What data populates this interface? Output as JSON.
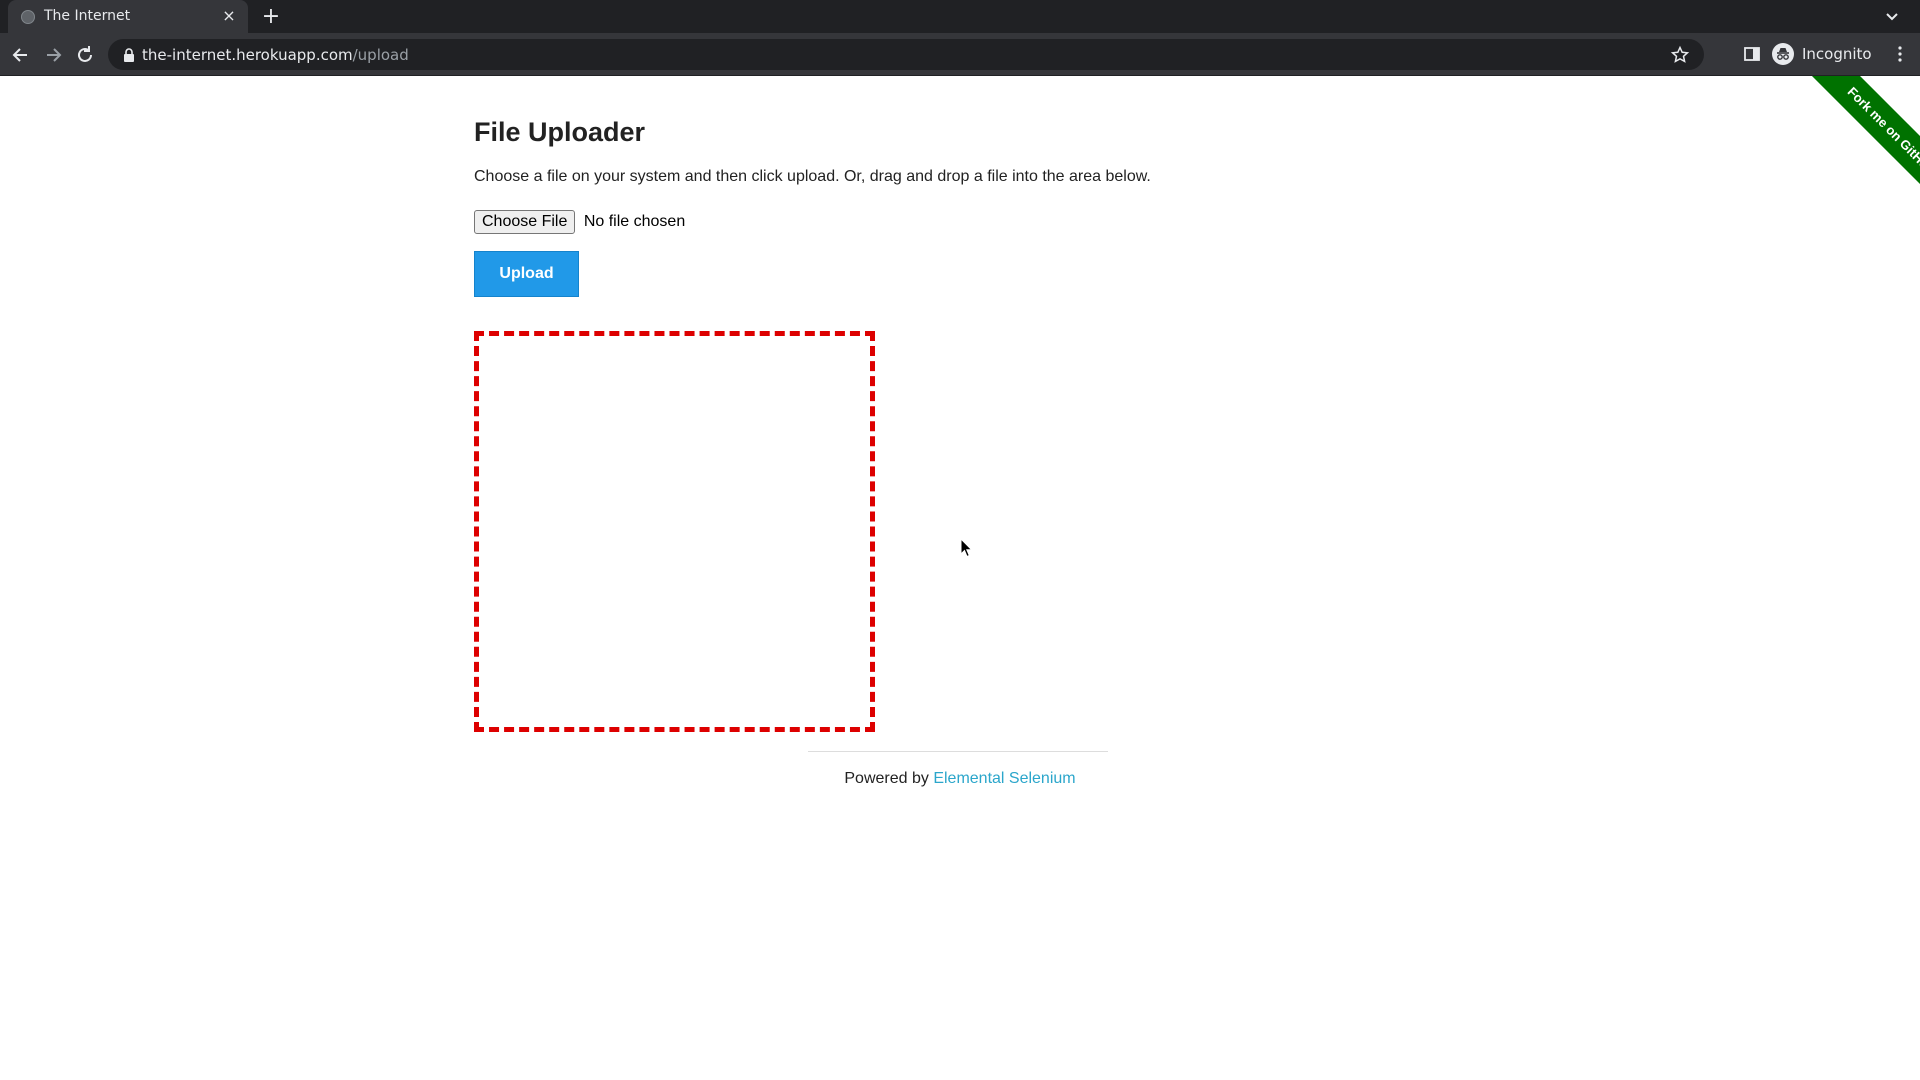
{
  "browser": {
    "tab": {
      "title": "The Internet",
      "close_glyph": "×",
      "favicon": "globe-icon"
    },
    "new_tab_glyph": "+",
    "address": {
      "host": "the-internet.herokuapp.com",
      "path": "/upload"
    },
    "profile": {
      "label": "Incognito"
    }
  },
  "page": {
    "title": "File Uploader",
    "instructions": "Choose a file on your system and then click upload. Or, drag and drop a file into the area below.",
    "file_input": {
      "button_label": "Choose File",
      "status": "No file chosen"
    },
    "upload_button": "Upload",
    "footer": {
      "prefix": "Powered by ",
      "link_text": "Elemental Selenium"
    },
    "ribbon": "Fork me on GitHub"
  },
  "colors": {
    "chrome_dark": "#202124",
    "chrome_tab": "#35363a",
    "upload_button": "#2199e8",
    "drop_zone_border": "#dd0000",
    "link": "#2ba6cb",
    "ribbon": "#007200"
  }
}
